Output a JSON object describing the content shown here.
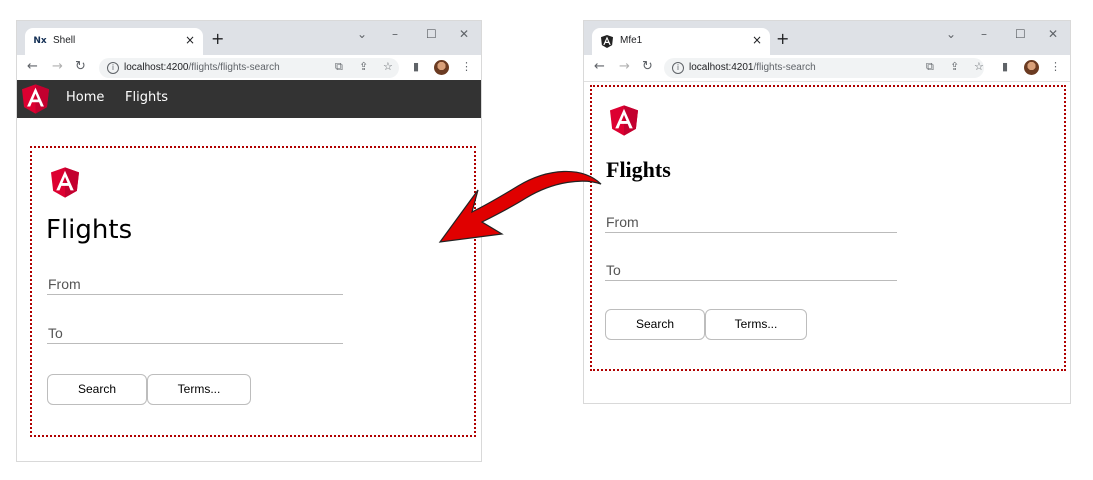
{
  "left_window": {
    "tab_title": "Shell",
    "tab_favicon": "Nx",
    "url_host": "localhost:4200",
    "url_path": "/flights/flights-search",
    "nav_links": [
      "Home",
      "Flights"
    ],
    "heading": "Flights",
    "from_label": "From",
    "to_label": "To",
    "search_label": "Search",
    "terms_label": "Terms..."
  },
  "right_window": {
    "tab_title": "Mfe1",
    "url_host": "localhost:4201",
    "url_path": "/flights-search",
    "heading": "Flights",
    "from_label": "From",
    "to_label": "To",
    "search_label": "Search",
    "terms_label": "Terms..."
  },
  "colors": {
    "arrow": "#e00000",
    "dotted_border": "#b00000",
    "navbar": "#333333",
    "angular_red": "#dd0031"
  },
  "icons": [
    "angular-logo-icon",
    "back-arrow-icon",
    "forward-arrow-icon",
    "reload-icon",
    "info-icon",
    "translate-icon",
    "share-icon",
    "star-icon",
    "side-panel-icon",
    "menu-dots-icon",
    "close-icon",
    "new-tab-icon",
    "minimize-icon",
    "maximize-icon",
    "tab-search-icon"
  ]
}
